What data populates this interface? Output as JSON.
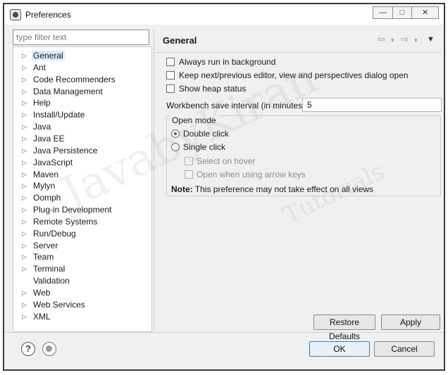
{
  "window": {
    "title": "Preferences",
    "controls": {
      "minimize": "—",
      "maximize": "□",
      "close": "✕"
    }
  },
  "filter": {
    "placeholder": "type filter text",
    "value": ""
  },
  "tree": {
    "items": [
      {
        "label": "General",
        "expandable": true,
        "selected": true
      },
      {
        "label": "Ant",
        "expandable": true
      },
      {
        "label": "Code Recommenders",
        "expandable": true
      },
      {
        "label": "Data Management",
        "expandable": true
      },
      {
        "label": "Help",
        "expandable": true
      },
      {
        "label": "Install/Update",
        "expandable": true
      },
      {
        "label": "Java",
        "expandable": true
      },
      {
        "label": "Java EE",
        "expandable": true
      },
      {
        "label": "Java Persistence",
        "expandable": true
      },
      {
        "label": "JavaScript",
        "expandable": true
      },
      {
        "label": "Maven",
        "expandable": true
      },
      {
        "label": "Mylyn",
        "expandable": true
      },
      {
        "label": "Oomph",
        "expandable": true
      },
      {
        "label": "Plug-in Development",
        "expandable": true
      },
      {
        "label": "Remote Systems",
        "expandable": true
      },
      {
        "label": "Run/Debug",
        "expandable": true
      },
      {
        "label": "Server",
        "expandable": true
      },
      {
        "label": "Team",
        "expandable": true
      },
      {
        "label": "Terminal",
        "expandable": true
      },
      {
        "label": "Validation",
        "expandable": false
      },
      {
        "label": "Web",
        "expandable": true
      },
      {
        "label": "Web Services",
        "expandable": true
      },
      {
        "label": "XML",
        "expandable": true
      }
    ],
    "arrow_glyph": "▷"
  },
  "content": {
    "title": "General",
    "nav": {
      "back": "⇦",
      "forward": "⇨",
      "dropdown": "▾",
      "menu": "▼"
    },
    "options": {
      "always_run_background": {
        "label": "Always run in background",
        "checked": false
      },
      "keep_next_previous": {
        "label": "Keep next/previous editor, view and perspectives dialog open",
        "checked": false
      },
      "show_heap_status": {
        "label": "Show heap status",
        "checked": false
      }
    },
    "save_interval": {
      "label": "Workbench save interval (in minutes):",
      "value": "5"
    },
    "open_mode": {
      "title": "Open mode",
      "double_click": {
        "label": "Double click",
        "selected": true
      },
      "single_click": {
        "label": "Single click",
        "selected": false
      },
      "select_on_hover": {
        "label": "Select on hover",
        "enabled": false
      },
      "open_arrow_keys": {
        "label": "Open when using arrow keys",
        "enabled": false
      }
    },
    "note": {
      "prefix": "Note:",
      "text": "This preference may not take effect on all views"
    },
    "buttons": {
      "restore_defaults": "Restore Defaults",
      "apply": "Apply"
    }
  },
  "footer": {
    "help_icon": "?",
    "buttons": {
      "ok": "OK",
      "cancel": "Cancel"
    }
  },
  "watermark": {
    "main": "JavabyKiran",
    "sub": "Tutorials"
  }
}
